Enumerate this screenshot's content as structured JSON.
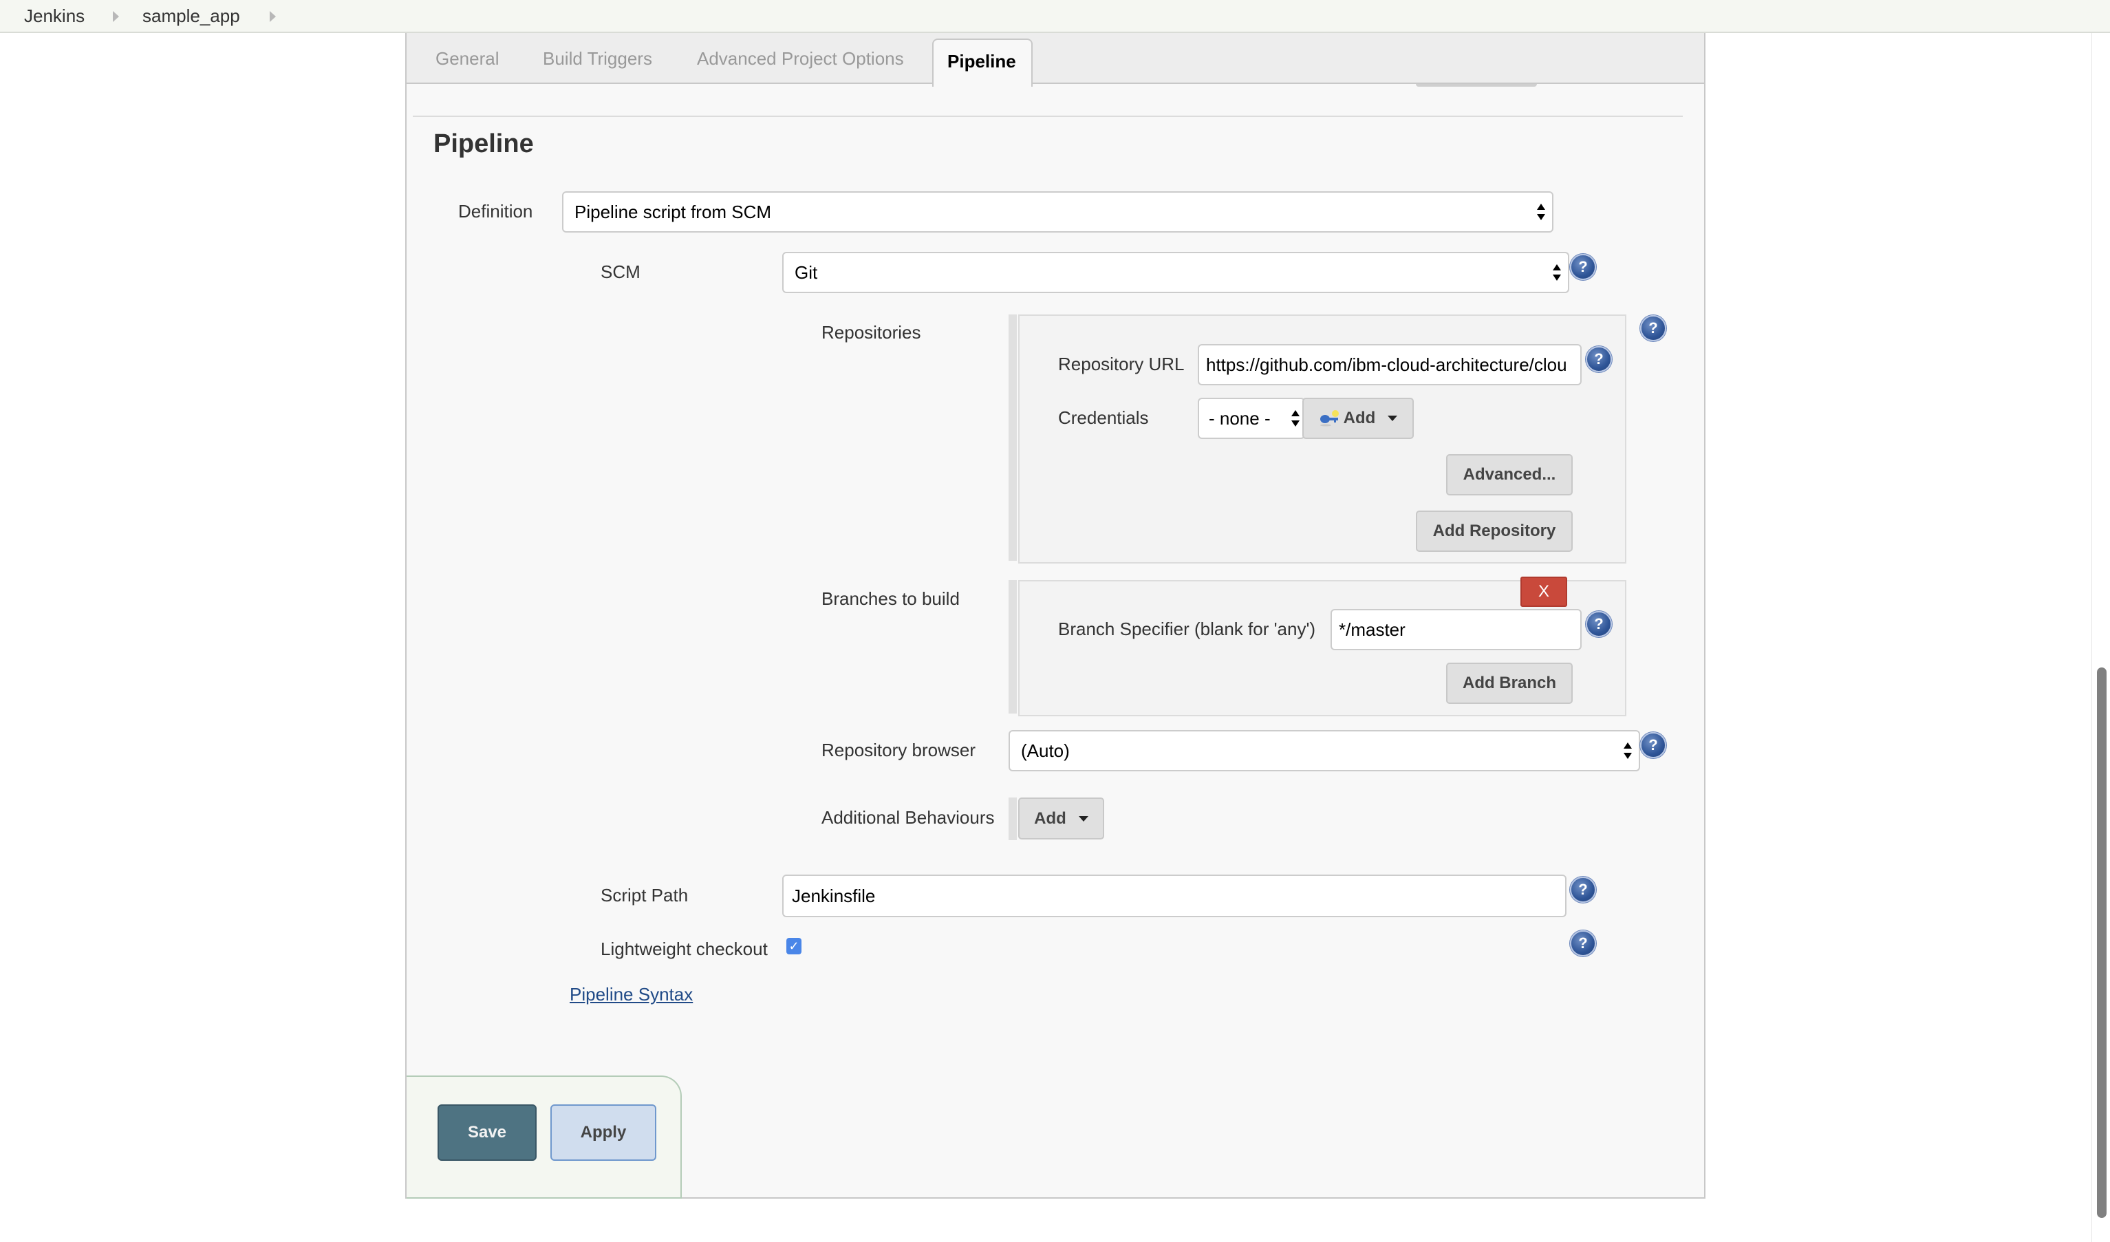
{
  "breadcrumb": {
    "items": [
      "Jenkins",
      "sample_app"
    ]
  },
  "tabs": [
    {
      "label": "General",
      "active": false
    },
    {
      "label": "Build Triggers",
      "active": false
    },
    {
      "label": "Advanced Project Options",
      "active": false
    },
    {
      "label": "Pipeline",
      "active": true
    }
  ],
  "section": {
    "title": "Pipeline"
  },
  "definition": {
    "label": "Definition",
    "value": "Pipeline script from SCM"
  },
  "scm": {
    "label": "SCM",
    "value": "Git"
  },
  "repositories": {
    "label": "Repositories",
    "url_label": "Repository URL",
    "url_value": "https://github.com/ibm-cloud-architecture/clou",
    "credentials_label": "Credentials",
    "credentials_value": "- none -",
    "add_label": "Add",
    "advanced_label": "Advanced...",
    "add_repository_label": "Add Repository"
  },
  "branches": {
    "label": "Branches to build",
    "delete_label": "X",
    "specifier_label": "Branch Specifier (blank for 'any')",
    "specifier_value": "*/master",
    "add_branch_label": "Add Branch"
  },
  "repo_browser": {
    "label": "Repository browser",
    "value": "(Auto)"
  },
  "additional_behaviours": {
    "label": "Additional Behaviours",
    "add_label": "Add"
  },
  "script_path": {
    "label": "Script Path",
    "value": "Jenkinsfile"
  },
  "lightweight_checkout": {
    "label": "Lightweight checkout",
    "checked": true,
    "check_glyph": "✓"
  },
  "pipeline_syntax_link": "Pipeline Syntax",
  "help_glyph": "?",
  "footer": {
    "save_label": "Save",
    "apply_label": "Apply"
  },
  "colors": {
    "save": "#4e7382",
    "apply": "#d0ddee",
    "delete": "#c9493b",
    "link": "#204a87",
    "help": "#2f5597"
  }
}
